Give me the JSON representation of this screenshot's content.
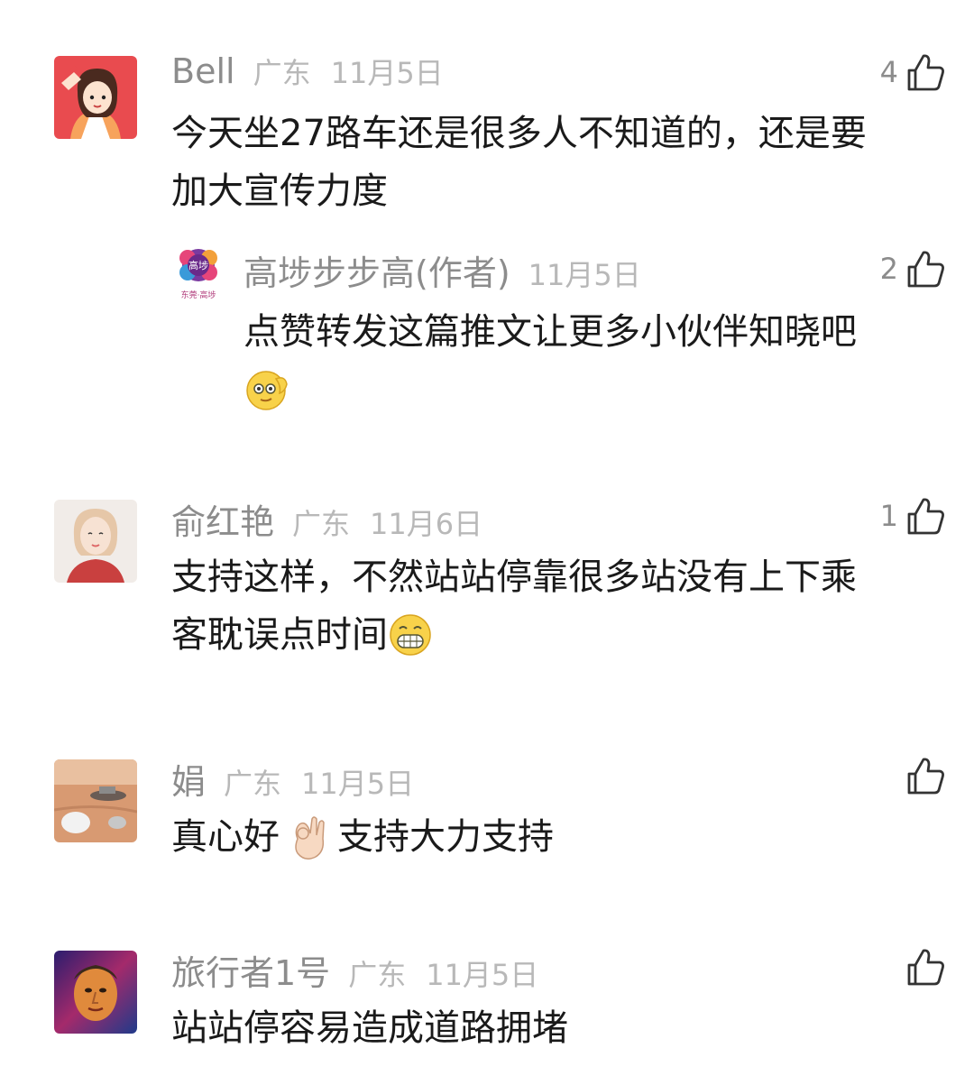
{
  "comments": [
    {
      "name": "Bell",
      "region": "广东",
      "date": "11月5日",
      "likes": "4",
      "text_line1": "今天坐27路车还是很多人不知道的，还是要",
      "text_line2": "加大宣传力度",
      "avatar_icon": "cartoon-girl-avatar",
      "reply": {
        "name": "高埗步步高(作者)",
        "date": "11月5日",
        "likes": "2",
        "text": "点赞转发这篇推文让更多小伙伴知晓吧",
        "emoji_icon": "wink-emoji",
        "avatar_icon": "logo-avatar",
        "avatar_caption": "东莞·高埗"
      }
    },
    {
      "name": "俞红艳",
      "region": "广东",
      "date": "11月6日",
      "likes": "1",
      "text_line1": "支持这样，不然站站停靠很多站没有上下乘",
      "text_line2": "客耽误点时间",
      "emoji_icon": "grin-emoji",
      "avatar_icon": "photo-avatar"
    },
    {
      "name": "娟",
      "region": "广东",
      "date": "11月5日",
      "likes": "",
      "text_before": "真心好",
      "text_after": "支持大力支持",
      "emoji_icon": "ok-hand-emoji",
      "avatar_icon": "mars-avatar"
    },
    {
      "name": "旅行者1号",
      "region": "广东",
      "date": "11月5日",
      "likes": "",
      "text_line1": "站站停容易造成道路拥堵",
      "avatar_icon": "portrait-avatar"
    }
  ],
  "colors": {
    "name": "#8c8c8c",
    "meta": "#b8b8b8",
    "text": "#1a1a1a"
  }
}
